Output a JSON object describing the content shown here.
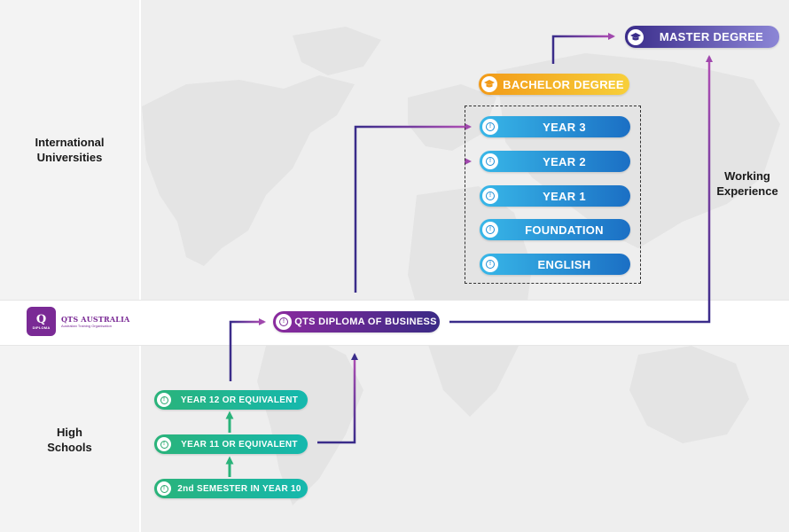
{
  "left_labels": {
    "universities": [
      "International",
      "Universities"
    ],
    "high_schools": [
      "High",
      "Schools"
    ]
  },
  "logo": {
    "mark_letter": "Q",
    "mark_text": "DIPLOMA",
    "name": "QTS AUSTRALIA",
    "tagline": "Australian Training Organisation"
  },
  "master_degree": {
    "label": "MASTER DEGREE",
    "icon": "graduation-cap-icon"
  },
  "bachelor_degree": {
    "label": "BACHELOR DEGREE",
    "icon": "graduation-cap-icon"
  },
  "university_steps": [
    {
      "label": "YEAR 3",
      "icon": "clock-icon"
    },
    {
      "label": "YEAR 2",
      "icon": "clock-icon"
    },
    {
      "label": "YEAR 1",
      "icon": "clock-icon"
    },
    {
      "label": "FOUNDATION",
      "icon": "clock-icon"
    },
    {
      "label": "ENGLISH",
      "icon": "clock-icon"
    }
  ],
  "diploma": {
    "label": "QTS DIPLOMA OF BUSINESS",
    "icon": "clock-icon"
  },
  "working_experience": [
    "Working",
    "Experience"
  ],
  "high_school_steps": [
    {
      "label": "YEAR 12 OR EQUIVALENT",
      "icon": "clock-icon"
    },
    {
      "label": "YEAR 11 OR EQUIVALENT",
      "icon": "clock-icon"
    },
    {
      "label": "2nd SEMESTER IN YEAR 10",
      "icon": "clock-icon"
    }
  ],
  "colors": {
    "purple": "#7a2a95",
    "indigo": "#3a2c8a",
    "blue": "#1b6fc4",
    "green": "#2ab37a",
    "orange": "#f29a18"
  }
}
